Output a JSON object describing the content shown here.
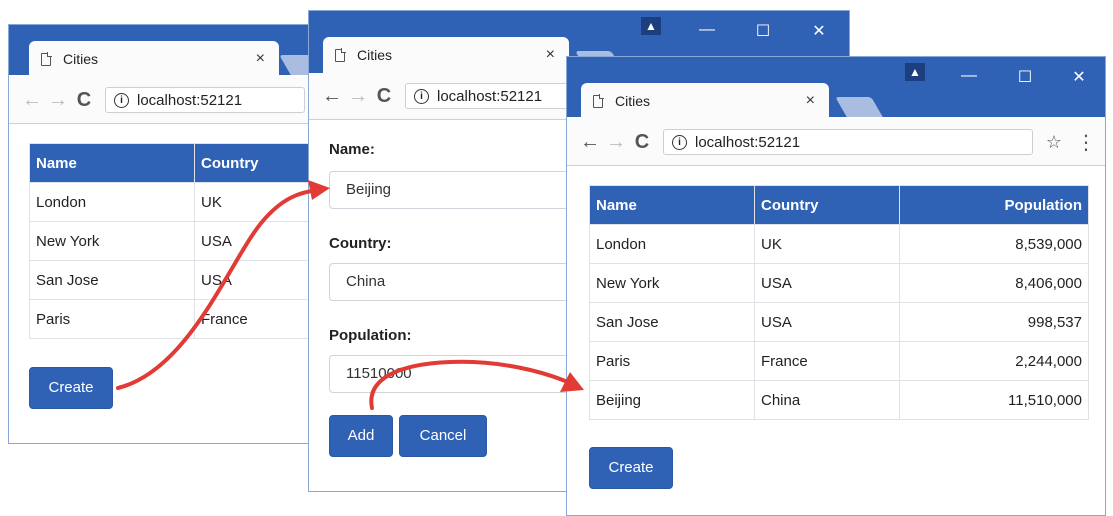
{
  "tab_title": "Cities",
  "tab_close": "×",
  "url": "localhost:52121",
  "icons": {
    "back": "←",
    "forward": "→",
    "reload": "C",
    "info": "i",
    "star": "☆",
    "menu": "⋮",
    "user": "▲",
    "minimize": "—",
    "maximize": "☐",
    "close": "✕"
  },
  "accent_color": "#2f61b4",
  "arrow_color": "#e23a35",
  "left_window": {
    "columns": [
      "Name",
      "Country"
    ],
    "rows": [
      [
        "London",
        "UK"
      ],
      [
        "New York",
        "USA"
      ],
      [
        "San Jose",
        "USA"
      ],
      [
        "Paris",
        "France"
      ]
    ],
    "create_label": "Create"
  },
  "middle_window": {
    "name_label": "Name:",
    "name_value": "Beijing",
    "country_label": "Country:",
    "country_value": "China",
    "population_label": "Population:",
    "population_value": "11510000",
    "add_label": "Add",
    "cancel_label": "Cancel"
  },
  "right_window": {
    "columns": [
      "Name",
      "Country",
      "Population"
    ],
    "rows": [
      [
        "London",
        "UK",
        "8,539,000"
      ],
      [
        "New York",
        "USA",
        "8,406,000"
      ],
      [
        "San Jose",
        "USA",
        "998,537"
      ],
      [
        "Paris",
        "France",
        "2,244,000"
      ],
      [
        "Beijing",
        "China",
        "11,510,000"
      ]
    ],
    "create_label": "Create"
  }
}
